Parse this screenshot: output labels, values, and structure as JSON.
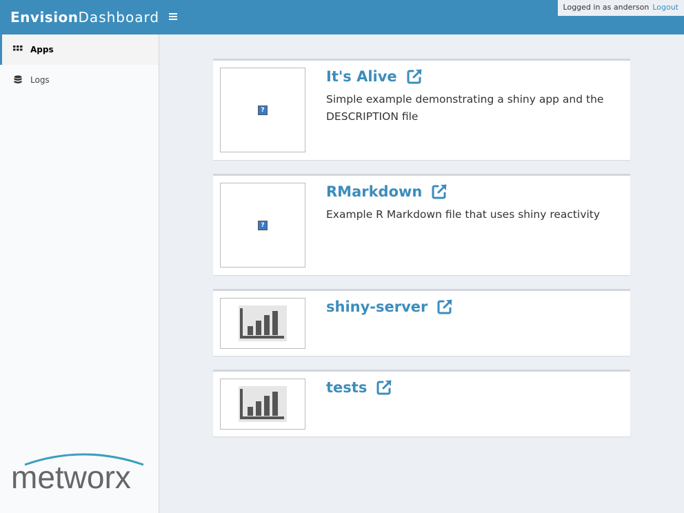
{
  "header": {
    "brand_bold": "Envision",
    "brand_light": "Dashboard",
    "user_text": "Logged in as anderson",
    "logout_label": "Logout"
  },
  "sidebar": {
    "items": [
      {
        "label": "Apps",
        "icon": "th-icon",
        "active": true
      },
      {
        "label": "Logs",
        "icon": "database-icon",
        "active": false
      }
    ],
    "logo_text": "metworx"
  },
  "apps": [
    {
      "title": "It's Alive",
      "description": "Simple example demonstrating a shiny app and the DESCRIPTION file",
      "thumbnail": "broken-image-icon"
    },
    {
      "title": "RMarkdown",
      "description": "Example R Markdown file that uses shiny reactivity",
      "thumbnail": "broken-image-icon"
    },
    {
      "title": "shiny-server",
      "description": "",
      "thumbnail": "bar-chart-icon"
    },
    {
      "title": "tests",
      "description": "",
      "thumbnail": "bar-chart-icon"
    }
  ],
  "colors": {
    "accent": "#3c8dbc",
    "background": "#ecf0f5",
    "sidebar": "#f9fafc"
  }
}
